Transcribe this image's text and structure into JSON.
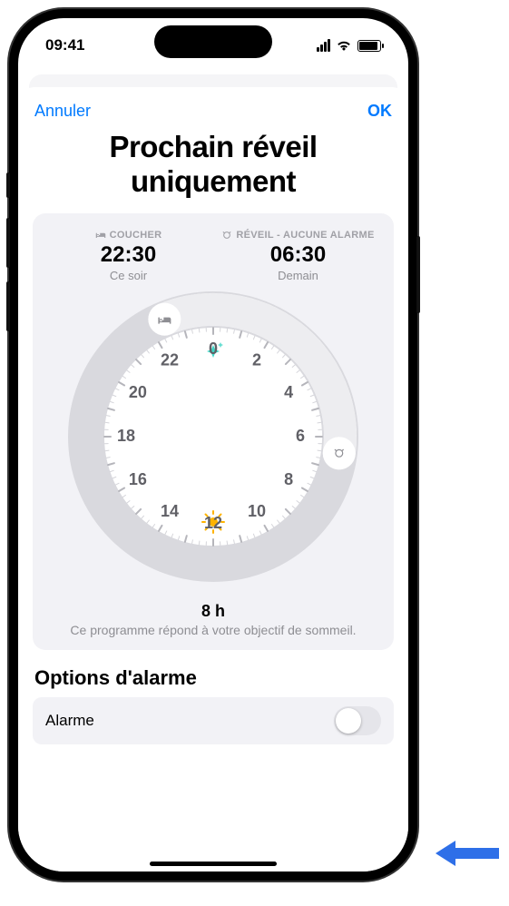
{
  "status": {
    "time": "09:41"
  },
  "nav": {
    "cancel": "Annuler",
    "ok": "OK"
  },
  "title": "Prochain réveil uniquement",
  "bedtime": {
    "caption": "COUCHER",
    "time": "22:30",
    "sub": "Ce soir"
  },
  "wake": {
    "caption": "RÉVEIL - AUCUNE ALARME",
    "time": "06:30",
    "sub": "Demain"
  },
  "dial": {
    "hours": [
      "0",
      "2",
      "4",
      "6",
      "8",
      "10",
      "12",
      "14",
      "16",
      "18",
      "20",
      "22"
    ]
  },
  "summary": {
    "hours": "8 h",
    "text": "Ce programme répond à votre objectif de sommeil."
  },
  "options": {
    "section": "Options d'alarme",
    "alarm_label": "Alarme"
  },
  "colors": {
    "accent": "#007aff",
    "arrow": "#2e6fe8"
  }
}
